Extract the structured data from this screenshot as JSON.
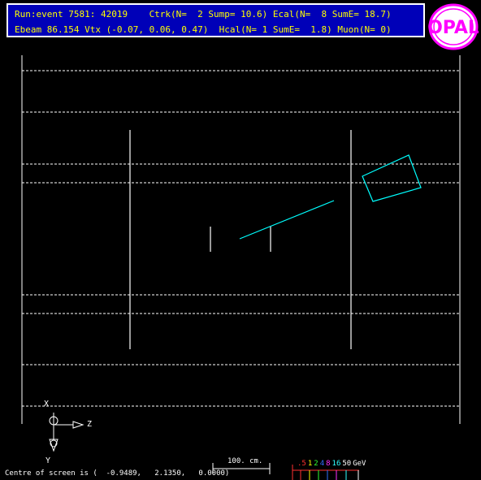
{
  "header": {
    "line1": "Run:event 7581: 42019    Ctrk(N=  2 Sump= 10.6) Ecal(N=  8 SumE= 18.7)",
    "line2": "Ebeam 86.154 Vtx (-0.07, 0.06, 0.47)  Hcal(N= 1 SumE=  1.8) Muon(N= 0)"
  },
  "logo": {
    "text": "OPAL",
    "ring_color": "#ff00ff",
    "fill_color": "#ffffff"
  },
  "axes": {
    "x_label": "X",
    "y_label": "Y",
    "z_label": "Z"
  },
  "scale": {
    "label": "100. cm."
  },
  "footer": {
    "centre_text": "Centre of screen is (  -0.9489,   2.1350,   0.0000)"
  },
  "energy_legend": {
    "items": [
      {
        "label": ".5",
        "color": "#ff3030"
      },
      {
        "label": "1",
        "color": "#ffff00"
      },
      {
        "label": "2",
        "color": "#30ff30"
      },
      {
        "label": "4",
        "color": "#3070ff"
      },
      {
        "label": "8",
        "color": "#ff30ff"
      },
      {
        "label": "16",
        "color": "#30ffff"
      },
      {
        "label": "50",
        "color": "#ffffff"
      },
      {
        "label": "GeV",
        "color": "#ffffff"
      }
    ]
  },
  "colors": {
    "detector_lines": "#ffffff",
    "track": "#00ffff",
    "header_bg": "#0000b8",
    "header_text": "#ffff00"
  }
}
